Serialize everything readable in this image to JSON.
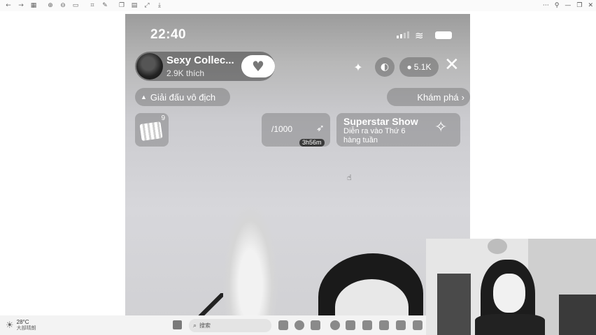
{
  "phone": {
    "status_time": "22:40",
    "creator": {
      "name": "Sexy Collec...",
      "likes": "2.9K thích"
    },
    "viewer_count": "5.1K",
    "tags": {
      "left": "Giải đấu vô địch",
      "right": "Khám phá"
    },
    "cards": {
      "cake_count": "9",
      "progress_value": "/1000",
      "timer": "3h56m",
      "show_title": "Superstar Show",
      "show_subtitle": "Diễn ra vào Thứ 6 hàng tuần"
    }
  },
  "taskbar": {
    "temperature": "28°C",
    "weather_desc": "大部晴朗",
    "search_label": "搜索"
  },
  "icons": {
    "wifi": "wifi-icon",
    "heart": "heart-plus-icon",
    "close": "close-icon",
    "person": "person-icon",
    "chevron": "chevron-right-icon",
    "flame": "flame-icon",
    "rocket": "rocket-icon",
    "sparkle": "sparkle-icon"
  }
}
